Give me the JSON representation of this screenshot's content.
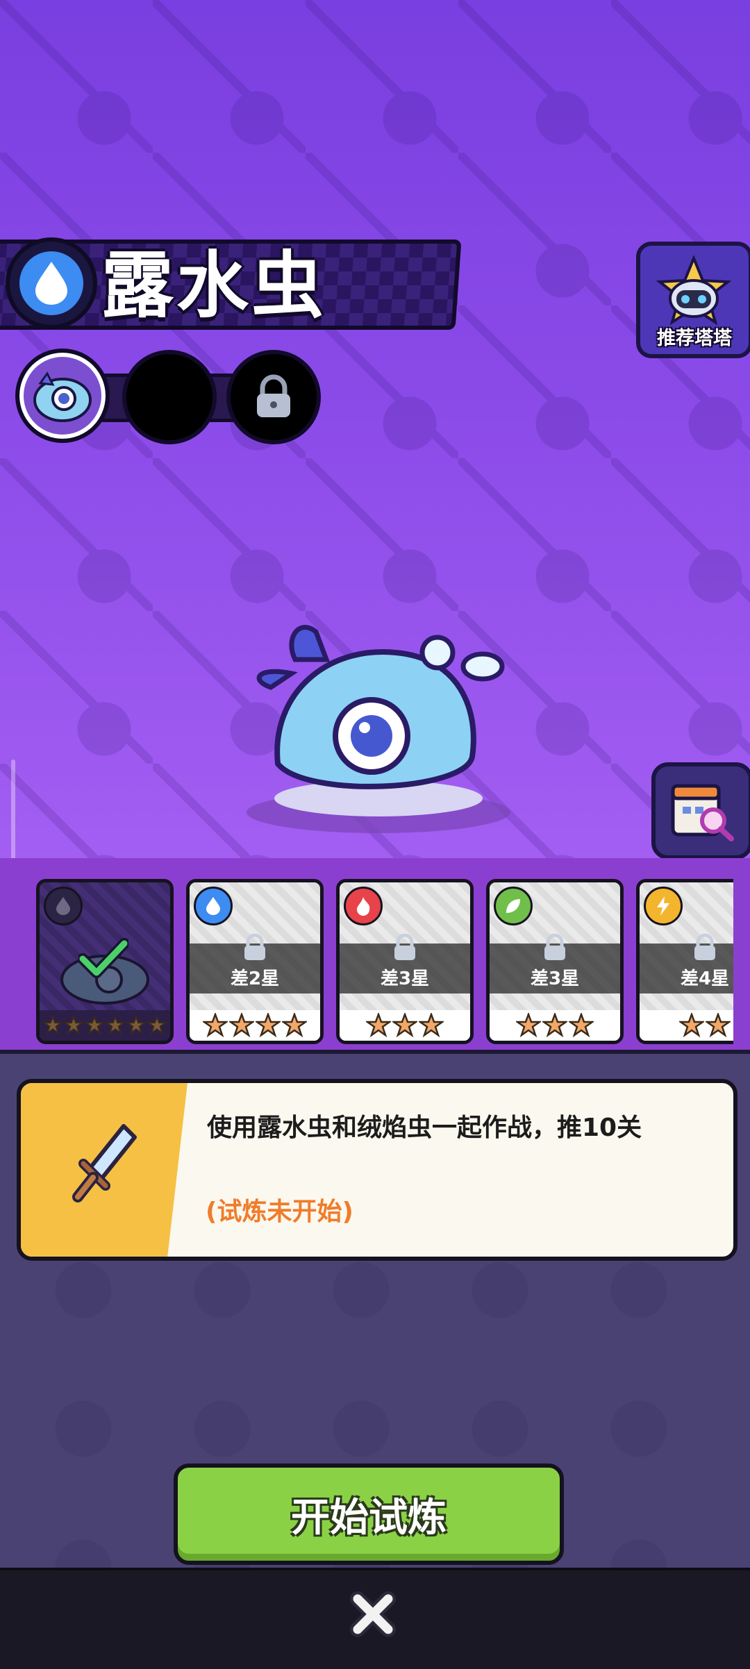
{
  "monster": {
    "name": "露水虫",
    "element_icon": "water-drop-icon"
  },
  "recommend": {
    "label": "推荐塔塔"
  },
  "cards": [
    {
      "element": "water",
      "status": "completed",
      "stars_total": 6,
      "stars_filled": 0,
      "requirement": ""
    },
    {
      "element": "water",
      "status": "locked",
      "stars_total": 4,
      "stars_filled": 4,
      "requirement": "差2星"
    },
    {
      "element": "fire",
      "status": "locked",
      "stars_total": 3,
      "stars_filled": 3,
      "requirement": "差3星"
    },
    {
      "element": "leaf",
      "status": "locked",
      "stars_total": 3,
      "stars_filled": 3,
      "requirement": "差3星"
    },
    {
      "element": "lightning",
      "status": "locked",
      "stars_total": 2,
      "stars_filled": 2,
      "requirement": "差4星"
    }
  ],
  "quest": {
    "description": "使用露水虫和绒焰虫一起作战，推10关",
    "status": "(试炼未开始)"
  },
  "start_button": {
    "label": "开始试炼"
  },
  "colors": {
    "water": "#3c8cf2",
    "fire": "#e8434a",
    "leaf": "#6fbf4a",
    "lightning": "#f4b52e",
    "start": "#8bd146",
    "quest_status": "#f07c2a"
  }
}
